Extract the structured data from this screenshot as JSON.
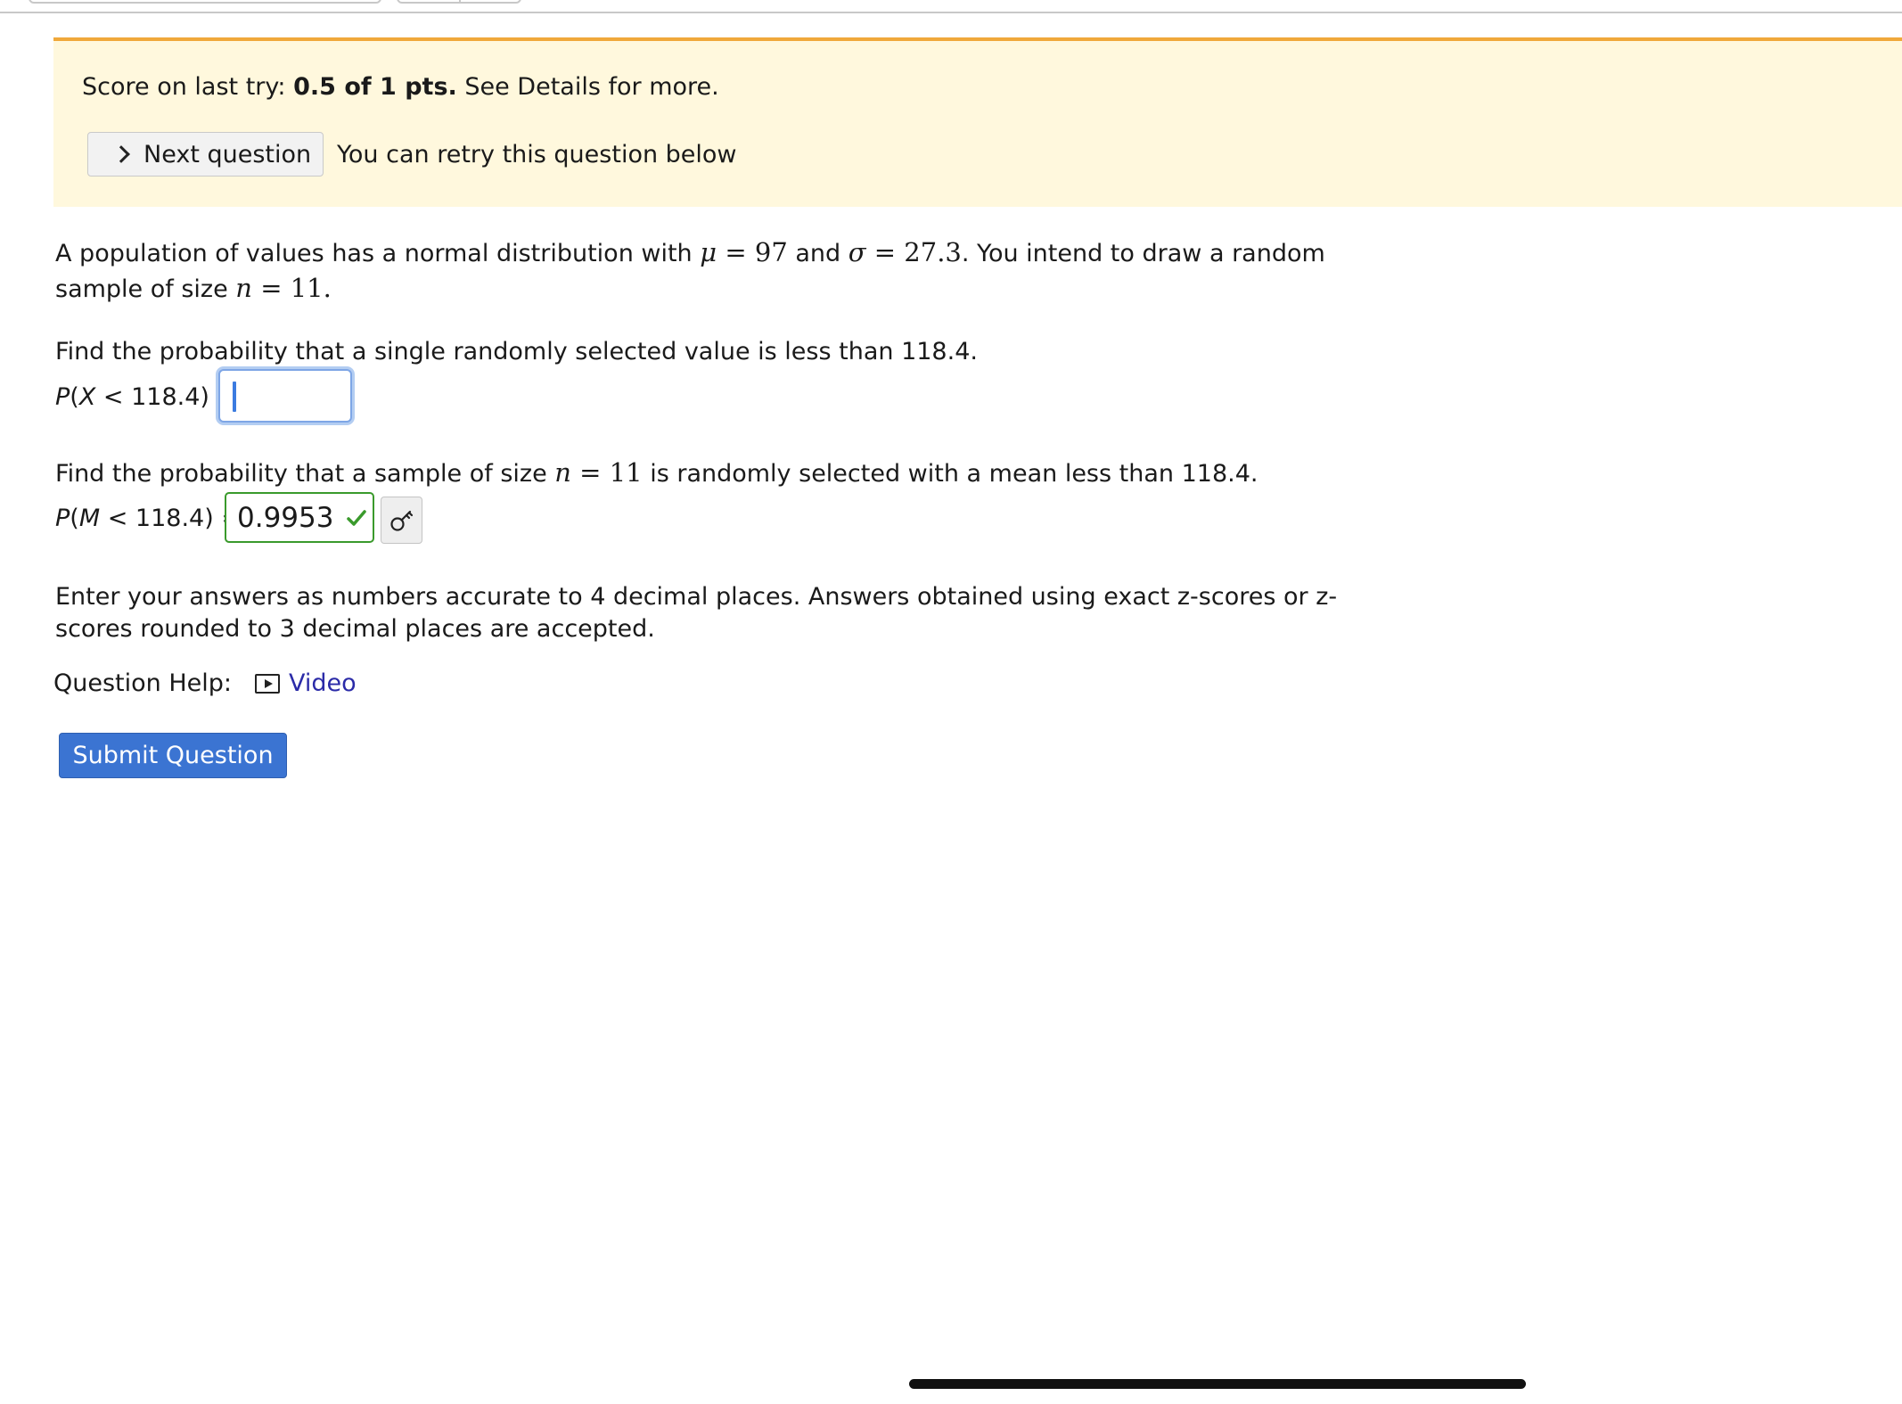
{
  "banner": {
    "score_prefix": "Score on last try: ",
    "score_value": "0.5 of 1 pts.",
    "score_suffix": " See Details for more.",
    "next_question_label": "Next question",
    "retry_text": "You can retry this question below",
    "accent_color": "#f0a83a",
    "background_color": "#fff8dd"
  },
  "problem": {
    "intro_1": "A population of values has a normal distribution with ",
    "mu_symbol": "μ",
    "mu_value": "97",
    "and_word": " and ",
    "sigma_symbol": "σ",
    "sigma_value": "27.3",
    "intro_2": ". You intend to draw a random",
    "intro_3": "sample of size ",
    "n_symbol": "n",
    "n_value": "11",
    "period": ".",
    "part1_prompt": "Find the probability that a single randomly selected value is less than 118.4.",
    "part1_label": "P(X < 118.4) =",
    "part1_value": "",
    "part2_prompt_1": "Find the probability that a sample of size ",
    "part2_prompt_2": " is randomly selected with a mean less than 118.4.",
    "part2_label": "P(M < 118.4) =",
    "part2_value": "0.9953",
    "part2_status": "correct",
    "instructions_line1": "Enter your answers as numbers accurate to 4 decimal places. Answers obtained using exact z-scores or z-",
    "instructions_line2": "scores rounded to 3 decimal places are accepted."
  },
  "help": {
    "label": "Question Help:",
    "video_label": "Video",
    "video_icon": "play-box-icon"
  },
  "submit": {
    "label": "Submit Question",
    "color": "#3b74d2"
  }
}
